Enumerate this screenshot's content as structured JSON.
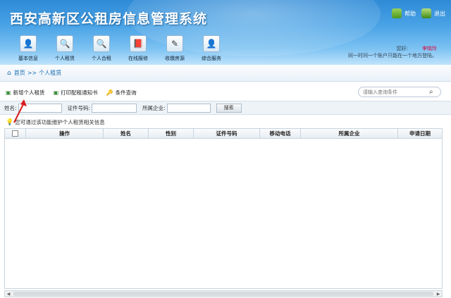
{
  "app": {
    "title": "西安高新区公租房信息管理系统"
  },
  "toplinks": {
    "help_label": "帮助",
    "exit_label": "退出"
  },
  "nav": {
    "items": [
      {
        "label": "基本信息",
        "icon": "person-doc-icon"
      },
      {
        "label": "个人租赁",
        "icon": "search-person-icon"
      },
      {
        "label": "个人合租",
        "icon": "search-person-icon"
      },
      {
        "label": "在线报修",
        "icon": "book-icon"
      },
      {
        "label": "收缴房源",
        "icon": "pencil-doc-icon"
      },
      {
        "label": "综合服务",
        "icon": "person-doc-icon"
      }
    ]
  },
  "user": {
    "greeting": "您好:",
    "name": "李晓玲",
    "notice": "同一时间一个账户只能在一个地方登陆。"
  },
  "breadcrumb": {
    "home": "首页",
    "separator": ">>",
    "current": "个人租赁"
  },
  "toolbar": {
    "add_label": "新增个人租赁",
    "print_label": "打印配租通知书",
    "query_label": "条件查询"
  },
  "search": {
    "placeholder": "请输入查询条件"
  },
  "filter": {
    "name_label": "姓名:",
    "id_label": "证件号码:",
    "company_label": "所属企业:",
    "search_button": "搜索"
  },
  "tip": {
    "text": "您可通过该功能维护个人租赁相关信息"
  },
  "table": {
    "columns": [
      "操作",
      "姓名",
      "性别",
      "证件号码",
      "移动电话",
      "所属企业",
      "申请日期"
    ]
  },
  "colors": {
    "header_top": "#2f8ad6",
    "header_bottom": "#bfe3fb",
    "link": "#1a6bb0",
    "annotation_arrow": "#d81e1e"
  }
}
